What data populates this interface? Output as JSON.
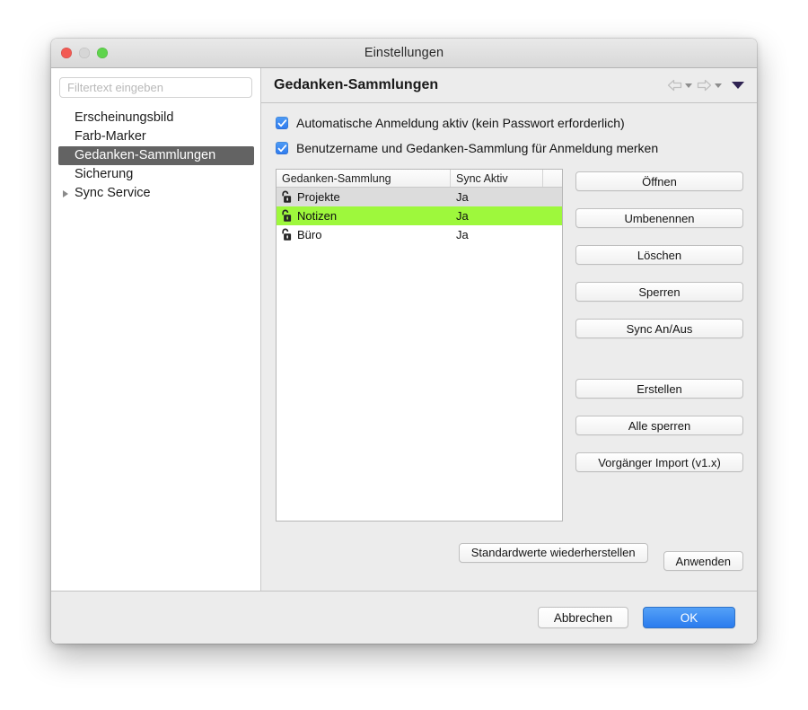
{
  "window": {
    "title": "Einstellungen",
    "traffic_lights": [
      "close-button",
      "minimize-button",
      "zoom-button"
    ]
  },
  "sidebar": {
    "filter_placeholder": "Filtertext eingeben",
    "filter_value": "",
    "items": [
      {
        "label": "Erscheinungsbild",
        "selected": false,
        "expandable": false
      },
      {
        "label": "Farb-Marker",
        "selected": false,
        "expandable": false
      },
      {
        "label": "Gedanken-Sammlungen",
        "selected": true,
        "expandable": false
      },
      {
        "label": "Sicherung",
        "selected": false,
        "expandable": false
      },
      {
        "label": "Sync Service",
        "selected": false,
        "expandable": true
      }
    ]
  },
  "header": {
    "title": "Gedanken-Sammlungen",
    "back_icon": "back-arrow-icon",
    "forward_icon": "forward-arrow-icon",
    "menu_icon": "dropdown-triangle-icon"
  },
  "options": [
    {
      "label": "Automatische Anmeldung aktiv (kein Passwort erforderlich)",
      "checked": true
    },
    {
      "label": "Benutzername und Gedanken-Sammlung für Anmeldung merken",
      "checked": true
    }
  ],
  "table": {
    "columns": [
      "Gedanken-Sammlung",
      "Sync Aktiv",
      ""
    ],
    "rows": [
      {
        "name": "Projekte",
        "sync": "Ja",
        "icon": "unlocked-padlock-icon",
        "state": "alternate"
      },
      {
        "name": "Notizen",
        "sync": "Ja",
        "icon": "unlocked-padlock-icon",
        "state": "highlighted"
      },
      {
        "name": "Büro",
        "sync": "Ja",
        "icon": "unlocked-padlock-icon",
        "state": "normal"
      }
    ]
  },
  "side_buttons": {
    "group_one": [
      "Öffnen",
      "Umbenennen",
      "Löschen",
      "Sperren",
      "Sync An/Aus"
    ],
    "group_two": [
      "Erstellen",
      "Alle sperren",
      "Vorgänger Import (v1.x)"
    ]
  },
  "apply_row": {
    "restore_defaults": "Standardwerte wiederherstellen",
    "apply": "Anwenden"
  },
  "footer": {
    "cancel": "Abbrechen",
    "ok": "OK"
  },
  "colors": {
    "highlight_green": "#9ef83c",
    "alternate_row": "#dcdcdc",
    "selection_gray": "#636363",
    "accent_blue": "#2f7bee",
    "window_chrome": "#ececec"
  }
}
